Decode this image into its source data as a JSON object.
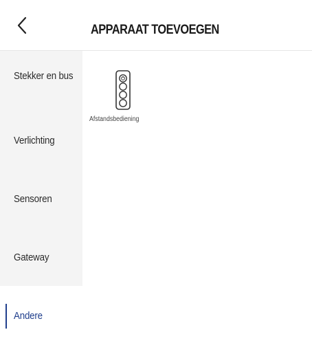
{
  "header": {
    "title": "APPARAAT TOEVOEGEN",
    "back_icon": "chevron-left-icon"
  },
  "sidebar": {
    "items": [
      {
        "label": "Stekker en bus",
        "active": false
      },
      {
        "label": "Verlichting",
        "active": false
      },
      {
        "label": "Sensoren",
        "active": false
      },
      {
        "label": "Gateway",
        "active": false
      },
      {
        "label": "Andere",
        "active": true
      }
    ]
  },
  "main": {
    "devices": [
      {
        "label": "Afstandsbediening",
        "icon": "remote-control-icon"
      }
    ]
  },
  "colors": {
    "accent": "#1f3e8c",
    "sidebar_background": "#f4f4f4"
  }
}
